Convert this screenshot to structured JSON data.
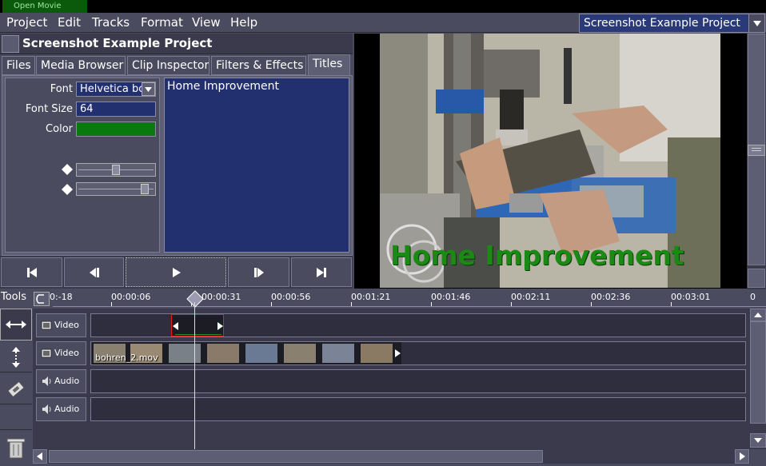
{
  "app": {
    "window_title": "Open Movie Editor"
  },
  "menu": {
    "project": "Project",
    "edit": "Edit",
    "tracks": "Tracks",
    "format": "Format",
    "view": "View",
    "help": "Help"
  },
  "project_selector": {
    "value": "Screenshot Example Project"
  },
  "project_panel": {
    "title": "Screenshot Example Project"
  },
  "tabs": [
    "Files",
    "Media Browser",
    "Clip Inspector",
    "Filters & Effects",
    "Titles"
  ],
  "titles_panel": {
    "font_label": "Font",
    "font_value": "Helvetica bo",
    "size_label": "Font Size",
    "size_value": "64",
    "color_label": "Color",
    "color_value": "#0a7a10",
    "text_value": "Home Improvement"
  },
  "preview": {
    "overlay_text": "Home Improvement",
    "overlay_color": "#1a8a14"
  },
  "timeline": {
    "tools_label": "Tools",
    "ticks": [
      "0:-18",
      "00:00:06",
      "00:00:31",
      "00:00:56",
      "00:01:21",
      "00:01:46",
      "00:02:11",
      "00:02:36",
      "00:03:01",
      "0"
    ],
    "tracks": [
      {
        "type": "Video",
        "icon": "film-icon"
      },
      {
        "type": "Video",
        "icon": "film-icon"
      },
      {
        "type": "Audio",
        "icon": "speaker-icon"
      },
      {
        "type": "Audio",
        "icon": "speaker-icon"
      }
    ],
    "clip_name": "bohren_2.mov"
  }
}
